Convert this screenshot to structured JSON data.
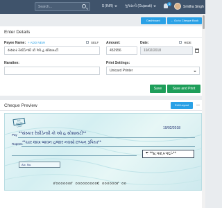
{
  "topbar": {
    "search_placeholder": "Search...",
    "currency": "$ (INR)",
    "language": "ગુજરાતી (Gujarati)",
    "notification_count": "4",
    "user_name": "Smitha Singh"
  },
  "actions": {
    "dashboard_label": "Dashboard",
    "cheque_book_label": "← Go to Cheque Book"
  },
  "form": {
    "title": "Enter Details",
    "payee_label": "Payee Name:",
    "add_new_label": "+ ADD NEW",
    "self_label": "SELF",
    "payee_value": "સંસ્કાર રેસીડેન્સી કો ઓ હ સોસાયટી",
    "amount_label": "Amount:",
    "amount_value": "452956",
    "date_label": "Date:",
    "hide_label": "HIDE",
    "date_value": "19/02/2018",
    "narration_label": "Naration:",
    "narration_value": "",
    "print_settings_label": "Print Settings:",
    "print_settings_value": "Unicard Printer",
    "save_label": "Save",
    "save_print_label": "Save and Print"
  },
  "preview": {
    "title": "Cheque Preview",
    "edit_layout_label": "Edit Layout",
    "stamp_text": "A/C PAYEE ONLY",
    "pay_label": "Pay",
    "payee_text": "**સંસ્કાર રેસીડેન્સી કો ઓ હ સોસાયટી**",
    "rupees_label": "Rupees",
    "rupees_words": "**ચાર લાખ બાવન હજાર નવસો છપ્પન રૂપિયા**",
    "amount_figure": "₹   **૪,૫૨,૯૫૬/-**",
    "ac_label": "A/c. No.",
    "micr_text": "⑈૦૦૦૦૦૦⑈ ૦૦૦૦૦૦૦૦૦⑆ ૦૦૦૦૦૦⑈ ૦૦"
  },
  "colors": {
    "topbar": "#3f536b",
    "accent_blue": "#2aa1e6",
    "save_green": "#1e9e5a"
  }
}
